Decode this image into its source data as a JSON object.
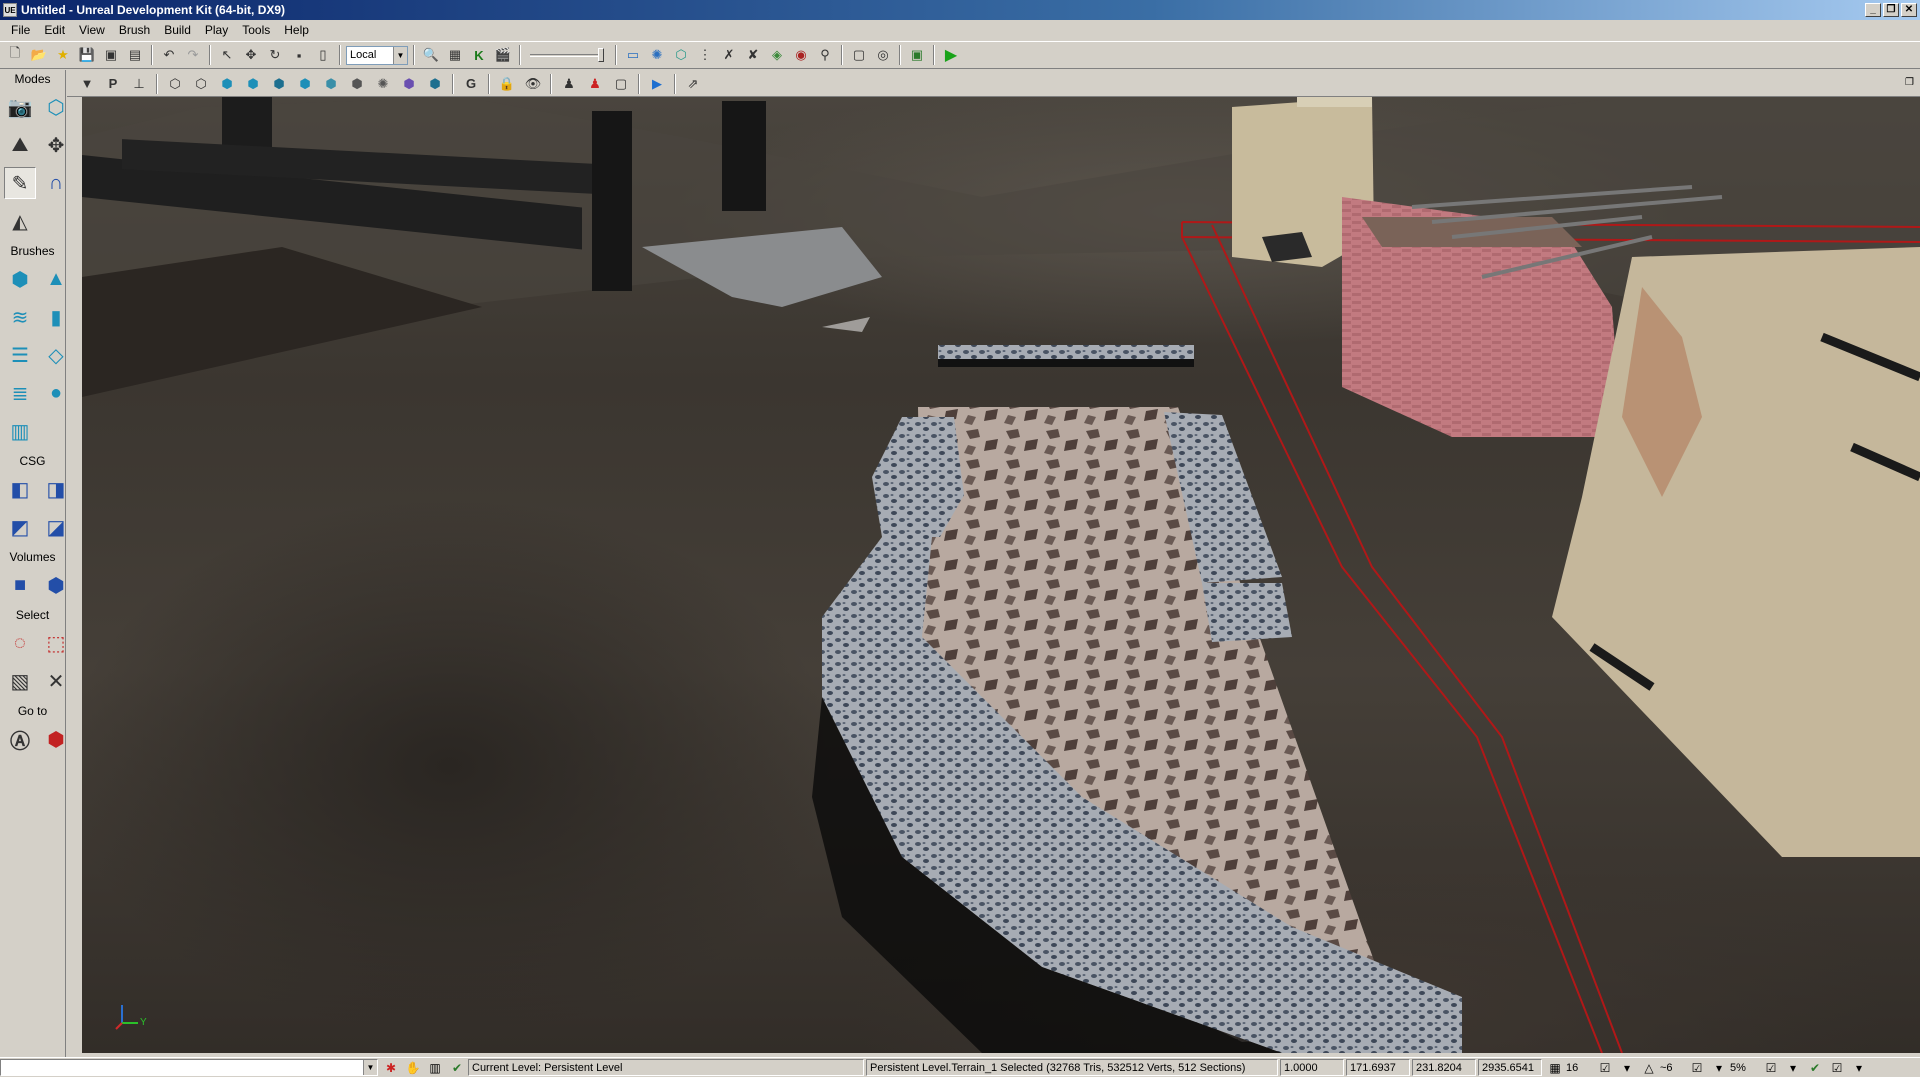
{
  "window": {
    "title": "Untitled - Unreal Development Kit (64-bit, DX9)",
    "app_icon": "UE",
    "minimize": "_",
    "restore": "❐",
    "close": "✕"
  },
  "menu": [
    "File",
    "Edit",
    "View",
    "Brush",
    "Build",
    "Play",
    "Tools",
    "Help"
  ],
  "toolbar": {
    "coord_system": "Local"
  },
  "modes": {
    "sections": [
      {
        "title": "Modes",
        "buttons": [
          "camera-mode",
          "geometry-mode",
          "terrain-mode",
          "texture-alignment-mode",
          "mesh-paint-mode",
          "static-mesh-mode",
          "landscape-mode"
        ]
      },
      {
        "title": "Brushes",
        "buttons": [
          "cube-brush",
          "cone-brush",
          "curved-stair-brush",
          "cylinder-brush",
          "linear-stair-brush",
          "sheet-brush",
          "spiral-stair-brush",
          "sphere-brush",
          "volumetric-brush"
        ]
      },
      {
        "title": "CSG",
        "buttons": [
          "csg-add",
          "csg-subtract",
          "csg-intersect",
          "csg-deintersect"
        ]
      },
      {
        "title": "Volumes",
        "buttons": [
          "add-volume",
          "volume-list"
        ]
      },
      {
        "title": "Select",
        "buttons": [
          "show-selected",
          "hide-selected",
          "select-inverse",
          "show-all"
        ]
      },
      {
        "title": "Go to",
        "buttons": [
          "go-to-actor",
          "go-to-builder-brush"
        ]
      }
    ]
  },
  "viewport": {
    "axis_label_y": "Y"
  },
  "statusbar": {
    "level_label": "Current Level:  Persistent Level",
    "selection": "Persistent Level.Terrain_1 Selected (32768 Tris, 532512 Verts, 512 Sections)",
    "drag_grid": "1.0000",
    "x": "171.6937",
    "y": "231.8204",
    "z": "2935.6541",
    "grid_size": "16",
    "rotation_snap": "~6",
    "scale_snap": "5%"
  }
}
